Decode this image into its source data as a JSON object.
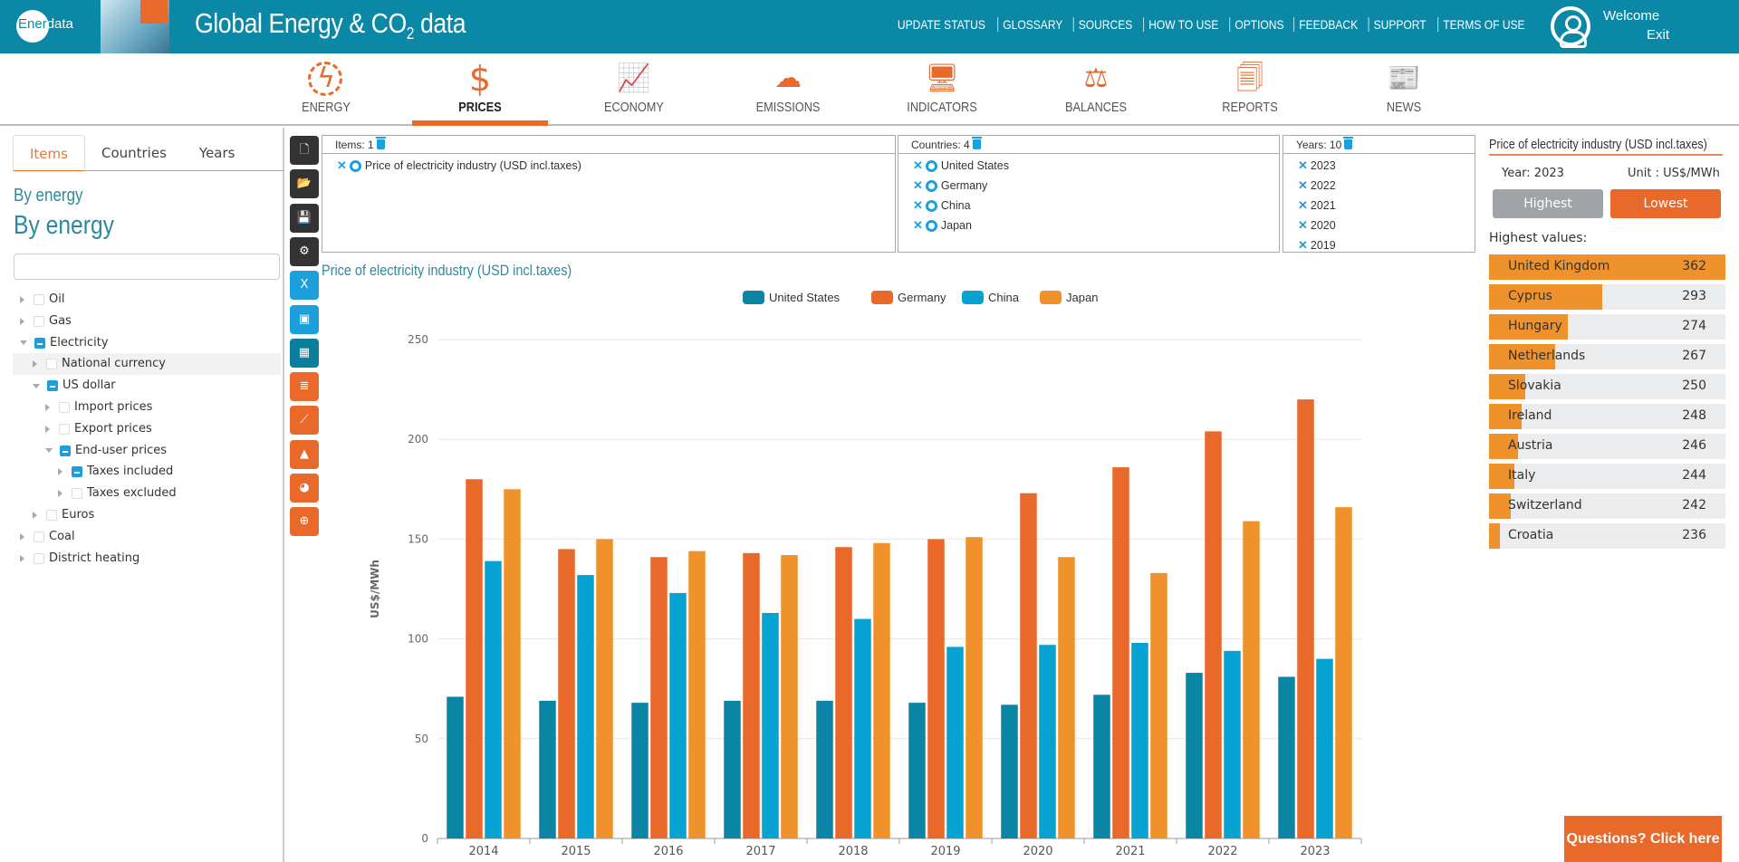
{
  "header": {
    "logo_prefix": "Ener",
    "logo_suffix": "data",
    "title_main": "Global Energy & CO",
    "title_sub": "2",
    "title_end": " data",
    "nav": [
      "UPDATE STATUS",
      "GLOSSARY",
      "SOURCES",
      "HOW TO USE",
      "OPTIONS",
      "FEEDBACK",
      "SUPPORT",
      "TERMS OF USE"
    ],
    "welcome": "Welcome",
    "exit": "Exit"
  },
  "mainnav": [
    {
      "label": "ENERGY",
      "icon": "lightning-icon",
      "active": false
    },
    {
      "label": "PRICES",
      "icon": "dollar-icon",
      "active": true
    },
    {
      "label": "ECONOMY",
      "icon": "growth-chart-icon",
      "active": false
    },
    {
      "label": "EMISSIONS",
      "icon": "co2-cloud-icon",
      "active": false
    },
    {
      "label": "INDICATORS",
      "icon": "monitor-chart-icon",
      "active": false
    },
    {
      "label": "BALANCES",
      "icon": "balance-scale-icon",
      "active": false
    },
    {
      "label": "REPORTS",
      "icon": "reports-icon",
      "active": false
    },
    {
      "label": "NEWS",
      "icon": "newspaper-icon",
      "active": false
    }
  ],
  "left": {
    "tabs": [
      "Items",
      "Countries",
      "Years"
    ],
    "active_tab": "Items",
    "heading_small": "By energy",
    "heading_large": "By energy",
    "search_value": "",
    "tree": [
      {
        "label": "Oil",
        "level": 0,
        "state": "closed",
        "check": "none"
      },
      {
        "label": "Gas",
        "level": 0,
        "state": "closed",
        "check": "none"
      },
      {
        "label": "Electricity",
        "level": 0,
        "state": "open",
        "check": "partial"
      },
      {
        "label": "National currency",
        "level": 1,
        "state": "closed",
        "check": "none",
        "highlight": true
      },
      {
        "label": "US dollar",
        "level": 1,
        "state": "open",
        "check": "partial"
      },
      {
        "label": "Import prices",
        "level": 2,
        "state": "closed",
        "check": "none"
      },
      {
        "label": "Export prices",
        "level": 2,
        "state": "closed",
        "check": "none"
      },
      {
        "label": "End-user prices",
        "level": 2,
        "state": "open",
        "check": "partial"
      },
      {
        "label": "Taxes included",
        "level": 3,
        "state": "closed",
        "check": "partial"
      },
      {
        "label": "Taxes excluded",
        "level": 3,
        "state": "closed",
        "check": "none"
      },
      {
        "label": "Euros",
        "level": 1,
        "state": "closed",
        "check": "none"
      },
      {
        "label": "Coal",
        "level": 0,
        "state": "closed",
        "check": "none"
      },
      {
        "label": "District heating",
        "level": 0,
        "state": "closed",
        "check": "none"
      }
    ]
  },
  "sidebuttons": [
    {
      "name": "new-file-icon",
      "glyph": "🗋",
      "color": "#333333"
    },
    {
      "name": "open-folder-icon",
      "glyph": "📂",
      "color": "#333333"
    },
    {
      "name": "save-icon",
      "glyph": "💾",
      "color": "#333333"
    },
    {
      "name": "settings-gear-icon",
      "glyph": "⚙",
      "color": "#333333"
    },
    {
      "name": "export-excel-icon",
      "glyph": "X",
      "color": "#1d9fdc"
    },
    {
      "name": "export-image-icon",
      "glyph": "▣",
      "color": "#1d9fdc"
    },
    {
      "name": "table-view-icon",
      "glyph": "▦",
      "color": "#0a7e9a"
    },
    {
      "name": "bar-chart-icon",
      "glyph": "≣",
      "color": "#e8692a"
    },
    {
      "name": "line-chart-icon",
      "glyph": "⟋",
      "color": "#e8692a"
    },
    {
      "name": "area-chart-icon",
      "glyph": "▲",
      "color": "#e8692a"
    },
    {
      "name": "pie-chart-icon",
      "glyph": "◕",
      "color": "#e8692a"
    },
    {
      "name": "globe-map-icon",
      "glyph": "⊕",
      "color": "#e8692a"
    }
  ],
  "selection": {
    "items": {
      "label": "Items: 1",
      "rows": [
        "Price of electricity industry (USD incl.taxes)"
      ]
    },
    "countries": {
      "label": "Countries: 4",
      "rows": [
        "United States",
        "Germany",
        "China",
        "Japan"
      ]
    },
    "years": {
      "label": "Years: 10",
      "rows": [
        "2023",
        "2022",
        "2021",
        "2020",
        "2019"
      ]
    }
  },
  "chart_data": {
    "type": "bar",
    "title": "Price of electricity industry (USD incl.taxes)",
    "xlabel": "",
    "ylabel": "US$/MWh",
    "ylim": [
      0,
      250
    ],
    "yticks": [
      0,
      50,
      100,
      150,
      200,
      250
    ],
    "grid": true,
    "legend_position": "top-center",
    "categories": [
      "2014",
      "2015",
      "2016",
      "2017",
      "2018",
      "2019",
      "2020",
      "2021",
      "2022",
      "2023"
    ],
    "series": [
      {
        "name": "United States",
        "color": "#0a86a4",
        "values": [
          71,
          69,
          68,
          69,
          69,
          68,
          67,
          72,
          83,
          81
        ]
      },
      {
        "name": "Germany",
        "color": "#e8692a",
        "values": [
          180,
          145,
          141,
          143,
          146,
          150,
          173,
          186,
          204,
          220
        ]
      },
      {
        "name": "China",
        "color": "#05a2d2",
        "values": [
          139,
          132,
          123,
          113,
          110,
          96,
          97,
          98,
          94,
          90
        ]
      },
      {
        "name": "Japan",
        "color": "#f0922b",
        "values": [
          175,
          150,
          144,
          142,
          148,
          151,
          141,
          133,
          159,
          166
        ]
      }
    ]
  },
  "right": {
    "title": "Price of electricity industry (USD incl.taxes)",
    "year": "Year: 2023",
    "unit": "Unit : US$/MWh",
    "highest_btn": "Highest",
    "lowest_btn": "Lowest",
    "list_label": "Highest values:",
    "ranking": [
      {
        "country": "United Kingdom",
        "value": 362
      },
      {
        "country": "Cyprus",
        "value": 293
      },
      {
        "country": "Hungary",
        "value": 274
      },
      {
        "country": "Netherlands",
        "value": 267
      },
      {
        "country": "Slovakia",
        "value": 250
      },
      {
        "country": "Ireland",
        "value": 248
      },
      {
        "country": "Austria",
        "value": 246
      },
      {
        "country": "Italy",
        "value": 244
      },
      {
        "country": "Switzerland",
        "value": 242
      },
      {
        "country": "Croatia",
        "value": 236
      }
    ]
  },
  "questions_btn": "Questions? Click here"
}
